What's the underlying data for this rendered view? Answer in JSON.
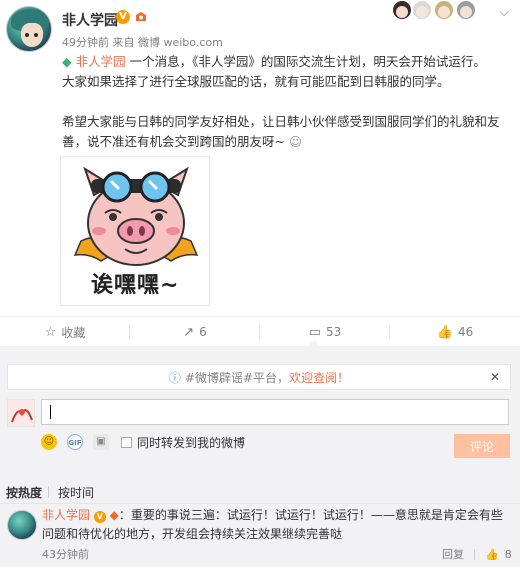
{
  "post": {
    "username": "非人学园",
    "meta": "49分钟前 来自 微博 weibo.com",
    "mention": "非人学园",
    "line1_rest": " 一个消息，《非人学园》的国际交流生计划，明天会开始试运行。",
    "line2": "大家如果选择了进行全球服匹配的话，就有可能匹配到日韩服的同学。",
    "line3": "希望大家能与日韩的同学友好相处，让日韩小伙伴感受到国服同学们的礼貌和友善，说不准还有机会交到跨国的朋友呀~",
    "sticker_caption": "诶嘿嘿~"
  },
  "actions": {
    "favorite": "收藏",
    "repost": "6",
    "comment": "53",
    "like": "46"
  },
  "comment_box": {
    "notice_prefix": "#微博辟谣#平台，",
    "notice_highlight": "欢迎查阅！",
    "share_label": "同时转发到我的微博",
    "submit_label": "评论"
  },
  "sort": {
    "hot": "按热度",
    "time": "按时间"
  },
  "comments": [
    {
      "name": "非人学园",
      "text": "：重要的事说三遍：试运行！试运行！试运行！——意思就是肯定会有些问题和待优化的地方，开发组会持续关注效果继续完善哒",
      "time": "43分钟前",
      "reply": "回复",
      "likes": "8"
    }
  ],
  "colors": {
    "accent": "#eb7350",
    "submit_bg": "#ffc09f",
    "panel_bg": "#f2f2f5",
    "verified": "#ff9a00"
  }
}
